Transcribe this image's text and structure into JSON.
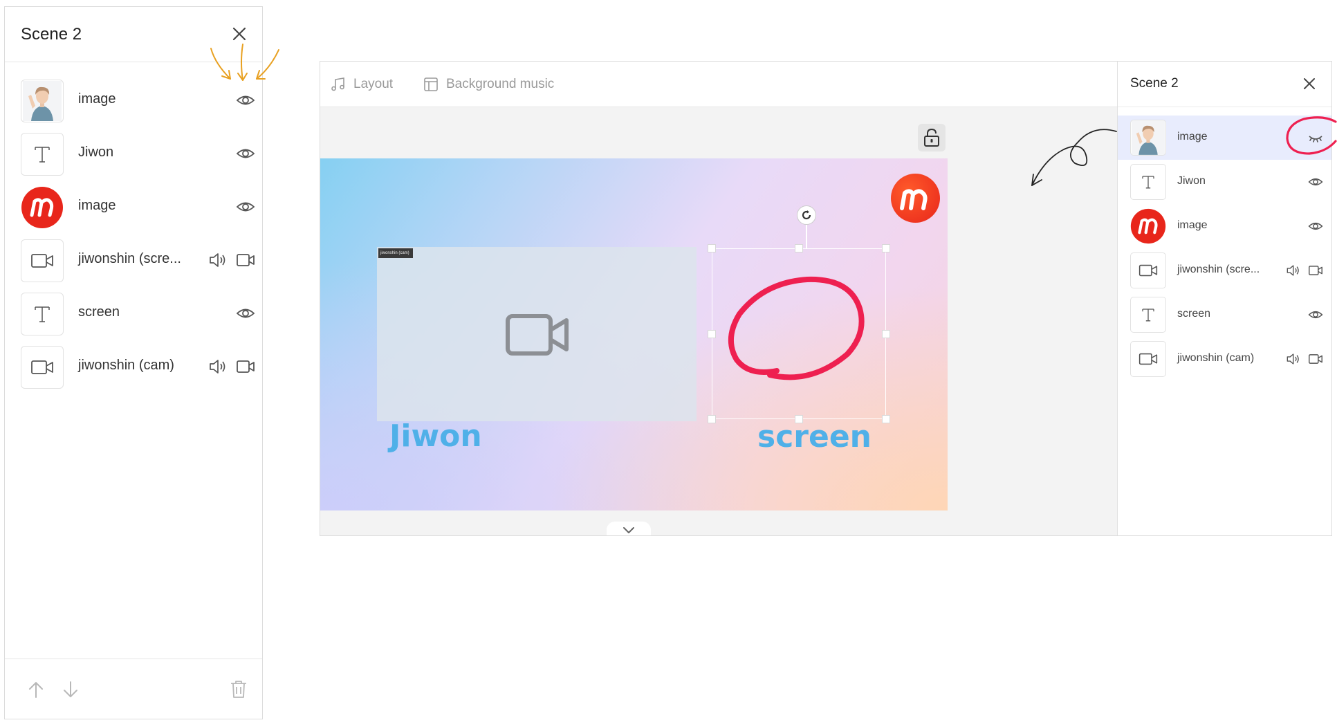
{
  "left_panel": {
    "title": "Scene 2",
    "layers": [
      {
        "label": "image",
        "thumb": "avatar"
      },
      {
        "label": "Jiwon",
        "thumb": "text"
      },
      {
        "label": "image",
        "thumb": "logo"
      },
      {
        "label": "jiwonshin (scre...",
        "thumb": "video"
      },
      {
        "label": "screen",
        "thumb": "text"
      },
      {
        "label": "jiwonshin (cam)",
        "thumb": "video"
      }
    ]
  },
  "editor": {
    "toolbar": {
      "layout_label": "Layout",
      "music_label": "Background music"
    },
    "stage": {
      "video_tag": "jiwonshin (cam)",
      "text_jiwon": "Jiwon",
      "text_screen": "screen"
    }
  },
  "right_panel": {
    "title": "Scene 2",
    "layers": [
      {
        "label": "image",
        "thumb": "avatar",
        "selected": true,
        "hidden": true
      },
      {
        "label": "Jiwon",
        "thumb": "text"
      },
      {
        "label": "image",
        "thumb": "logo"
      },
      {
        "label": "jiwonshin (scre...",
        "thumb": "video"
      },
      {
        "label": "screen",
        "thumb": "text"
      },
      {
        "label": "jiwonshin (cam)",
        "thumb": "video"
      }
    ]
  },
  "colors": {
    "accent_red": "#ee2050",
    "annotation_orange": "#e8a020",
    "selected_row": "#e8ecfd",
    "stage_text": "#4fb0e8",
    "logo_red": "#e8261b"
  },
  "icons": {
    "close": "close-icon",
    "visible": "eye-icon",
    "hidden": "eye-closed-icon",
    "audio": "speaker-icon",
    "video": "video-camera-icon",
    "up": "arrow-up-icon",
    "down": "arrow-down-icon",
    "delete": "trash-icon",
    "lock": "unlock-icon",
    "layout": "music-note-icon",
    "music": "layout-icon"
  }
}
